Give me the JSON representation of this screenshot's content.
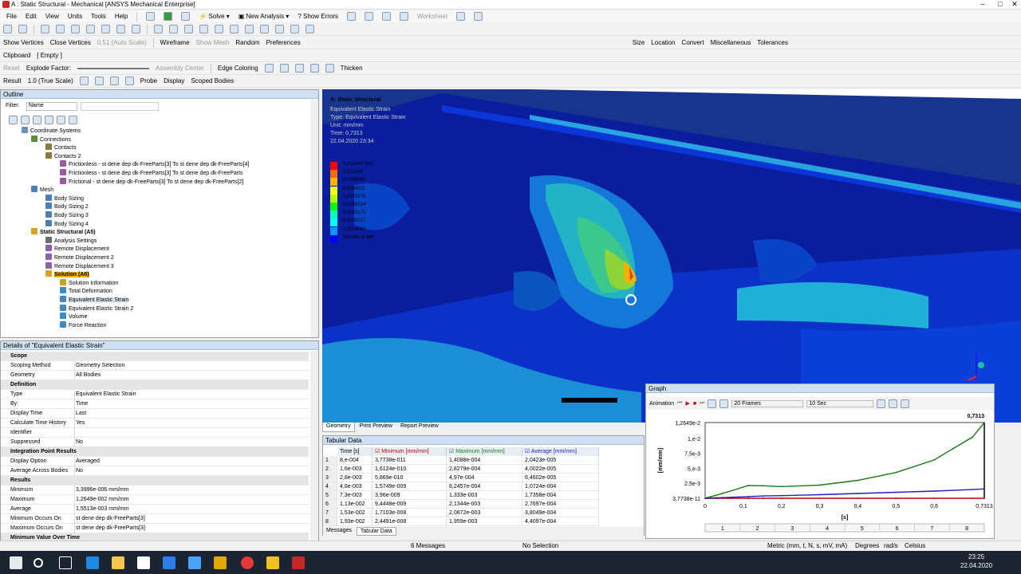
{
  "window": {
    "title": "A : Static Structural - Mechanical [ANSYS Mechanical Enterprise]"
  },
  "menu": [
    "File",
    "Edit",
    "View",
    "Units",
    "Tools",
    "Help"
  ],
  "toolbar1": {
    "solve": "Solve",
    "new_analysis": "New Analysis",
    "show_errors": "Show Errors",
    "worksheet": "Worksheet"
  },
  "toolbar2": {
    "show_vertices": "Show Vertices",
    "close_vertices": "Close Vertices",
    "auto_scale": "0,51 (Auto Scale)",
    "wireframe": "Wireframe",
    "show_mesh": "Show Mesh",
    "random": "Random",
    "preferences": "Preferences",
    "size": "Size",
    "location": "Location",
    "convert": "Convert",
    "miscellaneous": "Miscellaneous",
    "tolerances": "Tolerances"
  },
  "toolbar3": {
    "clipboard": "Clipboard",
    "clipboard_state": "[ Empty ]"
  },
  "toolbar4": {
    "reset": "Reset",
    "explode_factor": "Explode Factor:",
    "assembly_center": "Assembly Center",
    "edge_coloring": "Edge Coloring",
    "thicken": "Thicken"
  },
  "toolbar5": {
    "result": "Result",
    "scale": "1.0 (True Scale)",
    "probe": "Probe",
    "display": "Display",
    "scoped_bodies": "Scoped Bodies"
  },
  "outline": {
    "title": "Outline",
    "filter_label": "Filter:",
    "filter_value": "Name",
    "items": [
      {
        "label": "Coordinate Systems",
        "color": "#6d8fbf"
      },
      {
        "label": "Connections",
        "color": "#5b8f3a"
      },
      {
        "label": "Contacts",
        "color": "#8d7a3d"
      },
      {
        "label": "Contacts 2",
        "color": "#8d7a3d"
      },
      {
        "label": "Frictionless - st dene dep dk-FreeParts[3] To st dene dep dk-FreeParts[4]",
        "color": "#9c5aa3"
      },
      {
        "label": "Frictionless - st dene dep dk-FreeParts[3] To st dene dep dk-FreeParts",
        "color": "#9c5aa3"
      },
      {
        "label": "Frictional - st dene dep dk-FreeParts[3] To st dene dep dk-FreeParts[2]",
        "color": "#9c5aa3"
      },
      {
        "label": "Mesh",
        "color": "#4c7fb8"
      },
      {
        "label": "Body Sizing",
        "color": "#4c7fb8"
      },
      {
        "label": "Body Sizing 2",
        "color": "#4c7fb8"
      },
      {
        "label": "Body Sizing 3",
        "color": "#4c7fb8"
      },
      {
        "label": "Body Sizing 4",
        "color": "#4c7fb8"
      },
      {
        "label": "Static Structural (A5)",
        "color": "#d9a31a"
      },
      {
        "label": "Analysis Settings",
        "color": "#6b6b6b"
      },
      {
        "label": "Remote Displacement",
        "color": "#8f5fb0"
      },
      {
        "label": "Remote Displacement 2",
        "color": "#8f5fb0"
      },
      {
        "label": "Remote Displacement 3",
        "color": "#8f5fb0"
      },
      {
        "label": "Solution (A6)",
        "color": "#d9a31a"
      },
      {
        "label": "Solution Information",
        "color": "#c7a32a"
      },
      {
        "label": "Total Deformation",
        "color": "#3c8bc4"
      },
      {
        "label": "Equivalent Elastic Strain",
        "color": "#3c8bc4"
      },
      {
        "label": "Equivalent Elastic Strain 2",
        "color": "#3c8bc4"
      },
      {
        "label": "Volume",
        "color": "#3c8bc4"
      },
      {
        "label": "Force Reaction",
        "color": "#3c8bc4"
      }
    ]
  },
  "details": {
    "title": "Details of \"Equivalent Elastic Strain\"",
    "rows": [
      {
        "k": "Scope",
        "v": "",
        "section": true
      },
      {
        "k": "Scoping Method",
        "v": "Geometry Selection"
      },
      {
        "k": "Geometry",
        "v": "All Bodies"
      },
      {
        "k": "Definition",
        "v": "",
        "section": true
      },
      {
        "k": "Type",
        "v": "Equivalent Elastic Strain"
      },
      {
        "k": "By",
        "v": "Time"
      },
      {
        "k": "Display Time",
        "v": "Last"
      },
      {
        "k": "Calculate Time History",
        "v": "Yes"
      },
      {
        "k": "Identifier",
        "v": ""
      },
      {
        "k": "Suppressed",
        "v": "No"
      },
      {
        "k": "Integration Point Results",
        "v": "",
        "section": true
      },
      {
        "k": "Display Option",
        "v": "Averaged"
      },
      {
        "k": "Average Across Bodies",
        "v": "No"
      },
      {
        "k": "Results",
        "v": "",
        "section": true
      },
      {
        "k": "Minimum",
        "v": "3,3996e-006 mm/mm"
      },
      {
        "k": "Maximum",
        "v": "1,2649e-002 mm/mm"
      },
      {
        "k": "Average",
        "v": "1,5513e-003 mm/mm"
      },
      {
        "k": "Minimum Occurs On",
        "v": "st dene dep dk-FreeParts[3]"
      },
      {
        "k": "Maximum Occurs On",
        "v": "st dene dep dk-FreeParts[3]"
      },
      {
        "k": "Minimum Value Over Time",
        "v": "",
        "section": true
      }
    ]
  },
  "viewport": {
    "label_title": "A: Static Structural",
    "label_lines": [
      "Equivalent Elastic Strain",
      "Type: Equivalent Elastic Strain",
      "Unit: mm/mm",
      "Time: 0,7313",
      "22.04.2020 23:34"
    ],
    "legend": [
      {
        "label": "0,012649 Max",
        "color": "#ff0000"
      },
      {
        "label": "0,011244",
        "color": "#ff6a00"
      },
      {
        "label": "0,0098385",
        "color": "#ffb400"
      },
      {
        "label": "0,0084331",
        "color": "#ffff00"
      },
      {
        "label": "0,0070278",
        "color": "#b4ff00"
      },
      {
        "label": "0,0056224",
        "color": "#00ff00"
      },
      {
        "label": "0,0042171",
        "color": "#00ffb4"
      },
      {
        "label": "0,0028117",
        "color": "#00ffff"
      },
      {
        "label": "0,0014063",
        "color": "#0096ff"
      },
      {
        "label": "3,3996e-6 Min",
        "color": "#0000ff"
      }
    ],
    "tabs": [
      "Geometry",
      "Print Preview",
      "Report Preview"
    ]
  },
  "graph": {
    "title": "Graph",
    "animation_label": "Animation",
    "frames": "20 Frames",
    "duration": "10 Sec",
    "current_time": "0,7313",
    "ylabel": "[mm/mm]",
    "xlabel": "[s]",
    "yticks": [
      "1,2649e-2",
      "1,e-2",
      "7,5e-3",
      "5,e-3",
      "2,5e-3",
      "3,7738e-11"
    ],
    "xticks": [
      "0",
      "0,1",
      "0,2",
      "0,3",
      "0,4",
      "0,5",
      "0,6",
      "0,7313"
    ],
    "frame_numbers": [
      "1",
      "2",
      "3",
      "4",
      "5",
      "6",
      "7",
      "8"
    ]
  },
  "chart_data": {
    "type": "line",
    "xlabel": "[s]",
    "ylabel": "[mm/mm]",
    "xlim": [
      0,
      0.7313
    ],
    "ylim": [
      0,
      0.012649
    ],
    "x": [
      0,
      0.008,
      0.016,
      0.028,
      0.046,
      0.073,
      0.113,
      0.153,
      0.2,
      0.3,
      0.4,
      0.5,
      0.6,
      0.7,
      0.7313
    ],
    "series": [
      {
        "name": "Minimum [mm/mm]",
        "color": "#c00000",
        "values": [
          0,
          3.7738e-11,
          1.6124e-10,
          5.869e-10,
          1.5749e-09,
          3.96e-09,
          9.4448e-09,
          1.7103e-08,
          2.4491e-08,
          3e-08,
          3.5e-08,
          4e-08,
          4.5e-08,
          5e-08,
          3.3996e-06
        ]
      },
      {
        "name": "Maximum [mm/mm]",
        "color": "#1a7a1a",
        "values": [
          0,
          0.00014088,
          0.00028279,
          0.000497,
          0.00082457,
          0.001333,
          0.0021344,
          0.0020872,
          0.001959,
          0.0022,
          0.003,
          0.0043,
          0.0064,
          0.0102,
          0.012649
        ]
      },
      {
        "name": "Average [mm/mm]",
        "color": "#2020c0",
        "values": [
          0,
          2.0423e-05,
          4.0022e-05,
          6.4602e-05,
          0.00010724,
          0.00017358,
          0.00027697,
          0.00038049,
          0.00044097,
          0.0006,
          0.0008,
          0.001,
          0.0012,
          0.00145,
          0.0015513
        ]
      }
    ]
  },
  "tabular": {
    "title": "Tabular Data",
    "headers": [
      "Time [s]",
      "Minimum [mm/mm]",
      "Maximum [mm/mm]",
      "Average [mm/mm]"
    ],
    "rows": [
      [
        "1",
        "8,e-004",
        "3,7738e-011",
        "1,4088e-004",
        "2,0423e-005"
      ],
      [
        "2",
        "1,6e-003",
        "1,6124e-010",
        "2,8279e-004",
        "4,0022e-005"
      ],
      [
        "3",
        "2,8e-003",
        "5,869e-010",
        "4,97e-004",
        "6,4602e-005"
      ],
      [
        "4",
        "4,6e-003",
        "1,5749e-009",
        "8,2457e-004",
        "1,0724e-004"
      ],
      [
        "5",
        "7,3e-003",
        "3,96e-009",
        "1,333e-003",
        "1,7358e-004"
      ],
      [
        "6",
        "1,13e-002",
        "9,4448e-009",
        "2,1344e-003",
        "2,7697e-004"
      ],
      [
        "7",
        "1,53e-002",
        "1,7103e-008",
        "2,0872e-003",
        "3,8049e-004"
      ],
      [
        "8",
        "1,93e-002",
        "2,4491e-008",
        "1,959e-003",
        "4,4097e-004"
      ]
    ],
    "tabs": [
      "Messages",
      "Tabular Data"
    ]
  },
  "status": {
    "messages": "6 Messages",
    "selection": "No Selection",
    "units": "Metric (mm, t, N, s, mV, mA)",
    "angle": "Degrees",
    "rate": "rad/s",
    "temp": "Celsius"
  },
  "taskbar": {
    "time": "23:25",
    "date": "22.04.2020"
  }
}
